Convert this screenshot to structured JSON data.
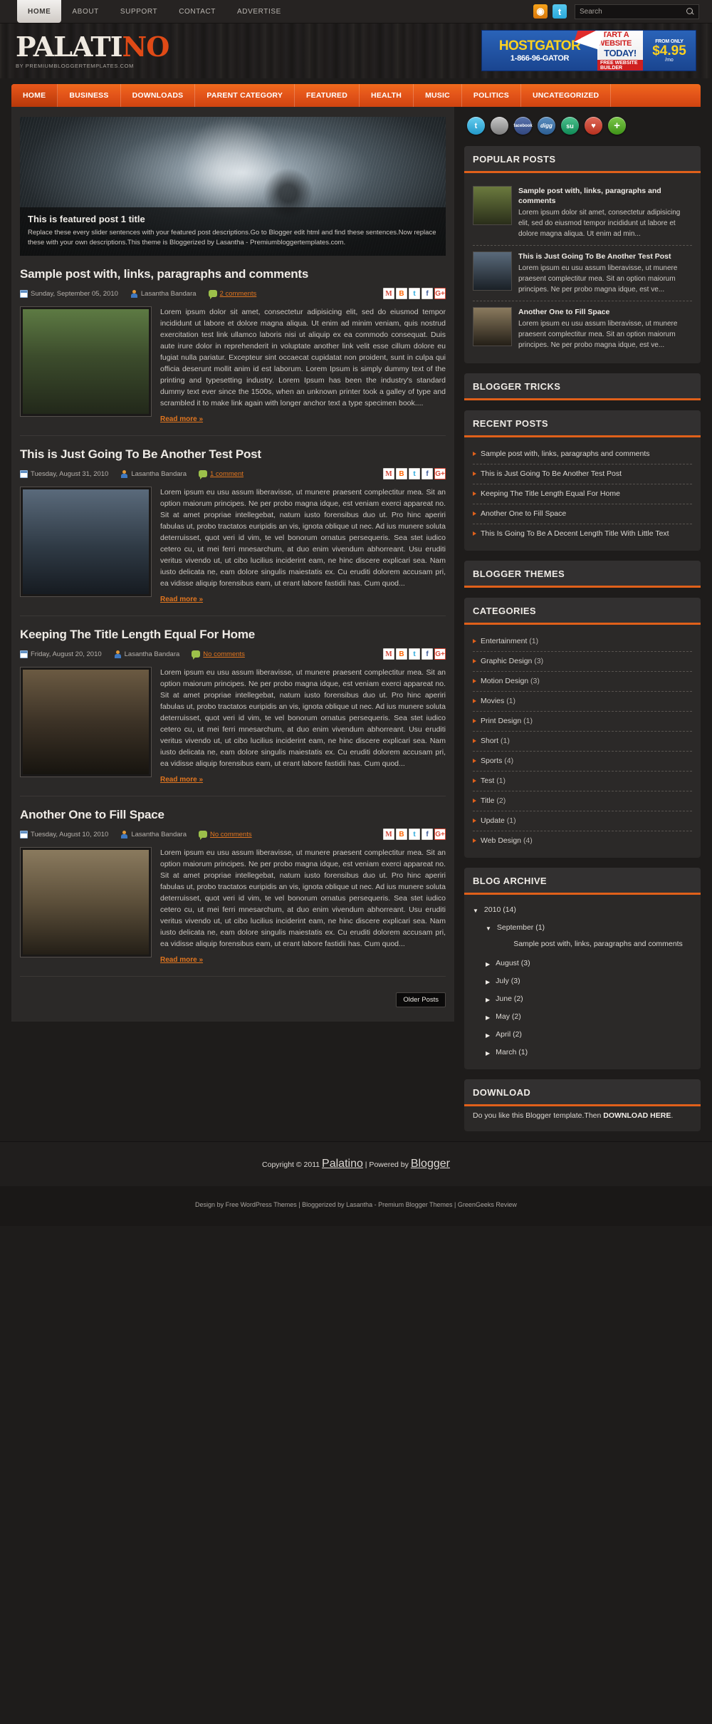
{
  "topbar": {
    "nav": [
      {
        "label": "HOME",
        "active": true
      },
      {
        "label": "ABOUT",
        "active": false
      },
      {
        "label": "SUPPORT",
        "active": false
      },
      {
        "label": "CONTACT",
        "active": false
      },
      {
        "label": "ADVERTISE",
        "active": false
      }
    ],
    "rss_icon": "rss-icon",
    "twitter_icon": "twitter-icon",
    "search_placeholder": "Search"
  },
  "header": {
    "logo_main": "PALATI",
    "logo_accent": "NO",
    "logo_sub": "BY PREMIUMBLOGGERTEMPLATES.COM",
    "banner": {
      "brand": "HOSTGATOR",
      "phone": "1-866-96-GATOR",
      "line1": "START A WEBSITE",
      "line2": "TODAY!",
      "line3": "FREE WEBSITE BUILDER",
      "from": "FROM ONLY",
      "price": "$4.95",
      "per": "/mo"
    }
  },
  "mainnav": [
    {
      "label": "HOME",
      "active": true
    },
    {
      "label": "BUSINESS",
      "active": false
    },
    {
      "label": "DOWNLOADS",
      "active": false
    },
    {
      "label": "PARENT CATEGORY",
      "active": false
    },
    {
      "label": "FEATURED",
      "active": false
    },
    {
      "label": "HEALTH",
      "active": false
    },
    {
      "label": "MUSIC",
      "active": false
    },
    {
      "label": "POLITICS",
      "active": false
    },
    {
      "label": "UNCATEGORIZED",
      "active": false
    }
  ],
  "slider": {
    "title": "This is featured post 1 title",
    "desc": "Replace these every slider sentences with your featured post descriptions.Go to Blogger edit html and find these sentences.Now replace these with your own descriptions.This theme is Bloggerized by Lasantha - Premiumbloggertemplates.com."
  },
  "share_icons": [
    {
      "name": "gmail-share-icon",
      "label": "M"
    },
    {
      "name": "blogger-share-icon",
      "label": "B"
    },
    {
      "name": "twitter-share-icon",
      "label": "t"
    },
    {
      "name": "facebook-share-icon",
      "label": "f"
    },
    {
      "name": "google-plus-share-icon",
      "label": "G+"
    }
  ],
  "posts": [
    {
      "title": "Sample post with, links, paragraphs and comments",
      "date": "Sunday, September 05, 2010",
      "author": "Lasantha Bandara",
      "comments": "2 comments",
      "body": "Lorem ipsum dolor sit amet, consectetur adipisicing elit, sed do eiusmod tempor incididunt ut labore et dolore magna aliqua. Ut enim ad minim veniam, quis nostrud exercitation test link ullamco laboris nisi ut aliquip ex ea commodo consequat. Duis aute irure dolor in reprehenderit in voluptate another link velit esse cillum dolore eu fugiat nulla pariatur. Excepteur sint occaecat cupidatat non proident, sunt in culpa qui officia deserunt mollit anim id est laborum. Lorem Ipsum is simply dummy text of the printing and typesetting industry. Lorem Ipsum has been the industry's standard dummy text ever since the 1500s, when an unknown printer took a galley of type and scrambled it to make link again with longer anchor text a type specimen book....",
      "readmore": "Read more »"
    },
    {
      "title": "This is Just Going To Be Another Test Post",
      "date": "Tuesday, August 31, 2010",
      "author": "Lasantha Bandara",
      "comments": "1 comment",
      "body": "Lorem ipsum eu usu assum liberavisse, ut munere praesent complectitur mea. Sit an option maiorum principes. Ne per probo magna idque, est veniam exerci appareat no. Sit at amet propriae intellegebat, natum iusto forensibus duo ut. Pro hinc aperiri fabulas ut, probo tractatos euripidis an vis, ignota oblique ut nec. Ad ius munere soluta deterruisset, quot veri id vim, te vel bonorum ornatus persequeris. Sea stet iudico cetero cu, ut mei ferri mnesarchum, at duo enim vivendum abhorreant. Usu eruditi veritus vivendo ut, ut cibo lucilius inciderint eam, ne hinc discere explicari sea. Nam iusto delicata ne, eam dolore singulis maiestatis ex. Cu eruditi dolorem accusam pri, ea vidisse aliquip forensibus eam, ut erant labore fastidii has. Cum quod...",
      "readmore": "Read more »"
    },
    {
      "title": "Keeping The Title Length Equal For Home",
      "date": "Friday, August 20, 2010",
      "author": "Lasantha Bandara",
      "comments": "No comments",
      "body": "Lorem ipsum eu usu assum liberavisse, ut munere praesent complectitur mea. Sit an option maiorum principes. Ne per probo magna idque, est veniam exerci appareat no. Sit at amet propriae intellegebat, natum iusto forensibus duo ut. Pro hinc aperiri fabulas ut, probo tractatos euripidis an vis, ignota oblique ut nec. Ad ius munere soluta deterruisset, quot veri id vim, te vel bonorum ornatus persequeris. Sea stet iudico cetero cu, ut mei ferri mnesarchum, at duo enim vivendum abhorreant. Usu eruditi veritus vivendo ut, ut cibo lucilius inciderint eam, ne hinc discere explicari sea. Nam iusto delicata ne, eam dolore singulis maiestatis ex. Cu eruditi dolorem accusam pri, ea vidisse aliquip forensibus eam, ut erant labore fastidii has. Cum quod...",
      "readmore": "Read more »"
    },
    {
      "title": "Another One to Fill Space",
      "date": "Tuesday, August 10, 2010",
      "author": "Lasantha Bandara",
      "comments": "No comments",
      "body": "Lorem ipsum eu usu assum liberavisse, ut munere praesent complectitur mea. Sit an option maiorum principes. Ne per probo magna idque, est veniam exerci appareat no. Sit at amet propriae intellegebat, natum iusto forensibus duo ut. Pro hinc aperiri fabulas ut, probo tractatos euripidis an vis, ignota oblique ut nec. Ad ius munere soluta deterruisset, quot veri id vim, te vel bonorum ornatus persequeris. Sea stet iudico cetero cu, ut mei ferri mnesarchum, at duo enim vivendum abhorreant. Usu eruditi veritus vivendo ut, ut cibo lucilius inciderint eam, ne hinc discere explicari sea. Nam iusto delicata ne, eam dolore singulis maiestatis ex. Cu eruditi dolorem accusam pri, ea vidisse aliquip forensibus eam, ut erant labore fastidii has. Cum quod...",
      "readmore": "Read more »"
    }
  ],
  "older_posts": "Older Posts",
  "sidebar": {
    "social": [
      {
        "name": "twitter-circle-icon",
        "label": "t"
      },
      {
        "name": "delicious-circle-icon",
        "label": ""
      },
      {
        "name": "facebook-circle-icon",
        "label": "facebook"
      },
      {
        "name": "digg-circle-icon",
        "label": "digg"
      },
      {
        "name": "stumbleupon-circle-icon",
        "label": "su"
      },
      {
        "name": "favorite-circle-icon",
        "label": "♥"
      },
      {
        "name": "share-more-circle-icon",
        "label": "+"
      }
    ],
    "popular_title": "POPULAR POSTS",
    "popular": [
      {
        "title": "Sample post with, links, paragraphs and comments",
        "excerpt": "Lorem ipsum dolor sit amet, consectetur adipisicing elit, sed do eiusmod tempor incididunt ut labore et dolore magna aliqua. Ut enim ad min..."
      },
      {
        "title": "This is Just Going To Be Another Test Post",
        "excerpt": "Lorem ipsum eu usu assum liberavisse, ut munere praesent complectitur mea. Sit an option maiorum principes. Ne per probo magna idque, est ve..."
      },
      {
        "title": "Another One to Fill Space",
        "excerpt": "Lorem ipsum eu usu assum liberavisse, ut munere praesent complectitur mea. Sit an option maiorum principes. Ne per probo magna idque, est ve..."
      }
    ],
    "blogger_tricks_title": "BLOGGER TRICKS",
    "recent_title": "RECENT POSTS",
    "recent": [
      "Sample post with, links, paragraphs and comments",
      "This is Just Going To Be Another Test Post",
      "Keeping The Title Length Equal For Home",
      "Another One to Fill Space",
      "This Is Going To Be A Decent Length Title With Little Text"
    ],
    "blogger_themes_title": "BLOGGER THEMES",
    "categories_title": "CATEGORIES",
    "categories": [
      {
        "name": "Entertainment",
        "count": "(1)"
      },
      {
        "name": "Graphic Design",
        "count": "(3)"
      },
      {
        "name": "Motion Design",
        "count": "(3)"
      },
      {
        "name": "Movies",
        "count": "(1)"
      },
      {
        "name": "Print Design",
        "count": "(1)"
      },
      {
        "name": "Short",
        "count": "(1)"
      },
      {
        "name": "Sports",
        "count": "(4)"
      },
      {
        "name": "Test",
        "count": "(1)"
      },
      {
        "name": "Title",
        "count": "(2)"
      },
      {
        "name": "Update",
        "count": "(1)"
      },
      {
        "name": "Web Design",
        "count": "(4)"
      }
    ],
    "archive_title": "BLOG ARCHIVE",
    "archive": {
      "year": "2010 (14)",
      "open_month": "September (1)",
      "open_post": "Sample post with, links, paragraphs and comments",
      "months": [
        "August (3)",
        "July (3)",
        "June (2)",
        "May (2)",
        "April (2)",
        "March (1)"
      ]
    },
    "download_title": "DOWNLOAD",
    "download_text": "Do you like this Blogger template.Then ",
    "download_link": "DOWNLOAD HERE",
    "download_tail": "."
  },
  "footer": {
    "copyright_pre": "Copyright © 2011 ",
    "copyright_site": "Palatino",
    "copyright_mid": " | Powered by ",
    "copyright_link": "Blogger",
    "credits": "Design by Free WordPress Themes | Bloggerized by Lasantha - Premium Blogger Themes | GreenGeeks Review"
  }
}
